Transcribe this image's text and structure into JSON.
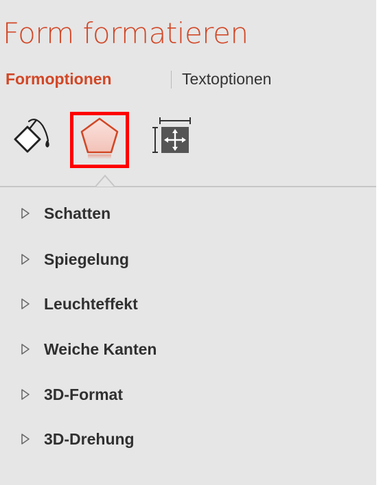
{
  "pane": {
    "title": "Form formatieren",
    "tabs": [
      {
        "label": "Formoptionen",
        "active": true
      },
      {
        "label": "Textoptionen",
        "active": false
      }
    ],
    "icons": [
      {
        "name": "fill-line-icon",
        "selected": false
      },
      {
        "name": "effects-pentagon-icon",
        "selected": true
      },
      {
        "name": "size-properties-icon",
        "selected": false
      }
    ],
    "sections": [
      {
        "label": "Schatten",
        "icon": "expand-triangle-icon"
      },
      {
        "label": "Spiegelung",
        "icon": "expand-triangle-icon"
      },
      {
        "label": "Leuchteffekt",
        "icon": "expand-triangle-icon"
      },
      {
        "label": "Weiche Kanten",
        "icon": "expand-triangle-icon"
      },
      {
        "label": "3D-Format",
        "icon": "expand-triangle-icon"
      },
      {
        "label": "3D-Drehung",
        "icon": "expand-triangle-icon"
      }
    ]
  },
  "colors": {
    "accent": "#d24726",
    "highlight_border": "#ff0000",
    "pane_background": "#e6e6e6"
  }
}
